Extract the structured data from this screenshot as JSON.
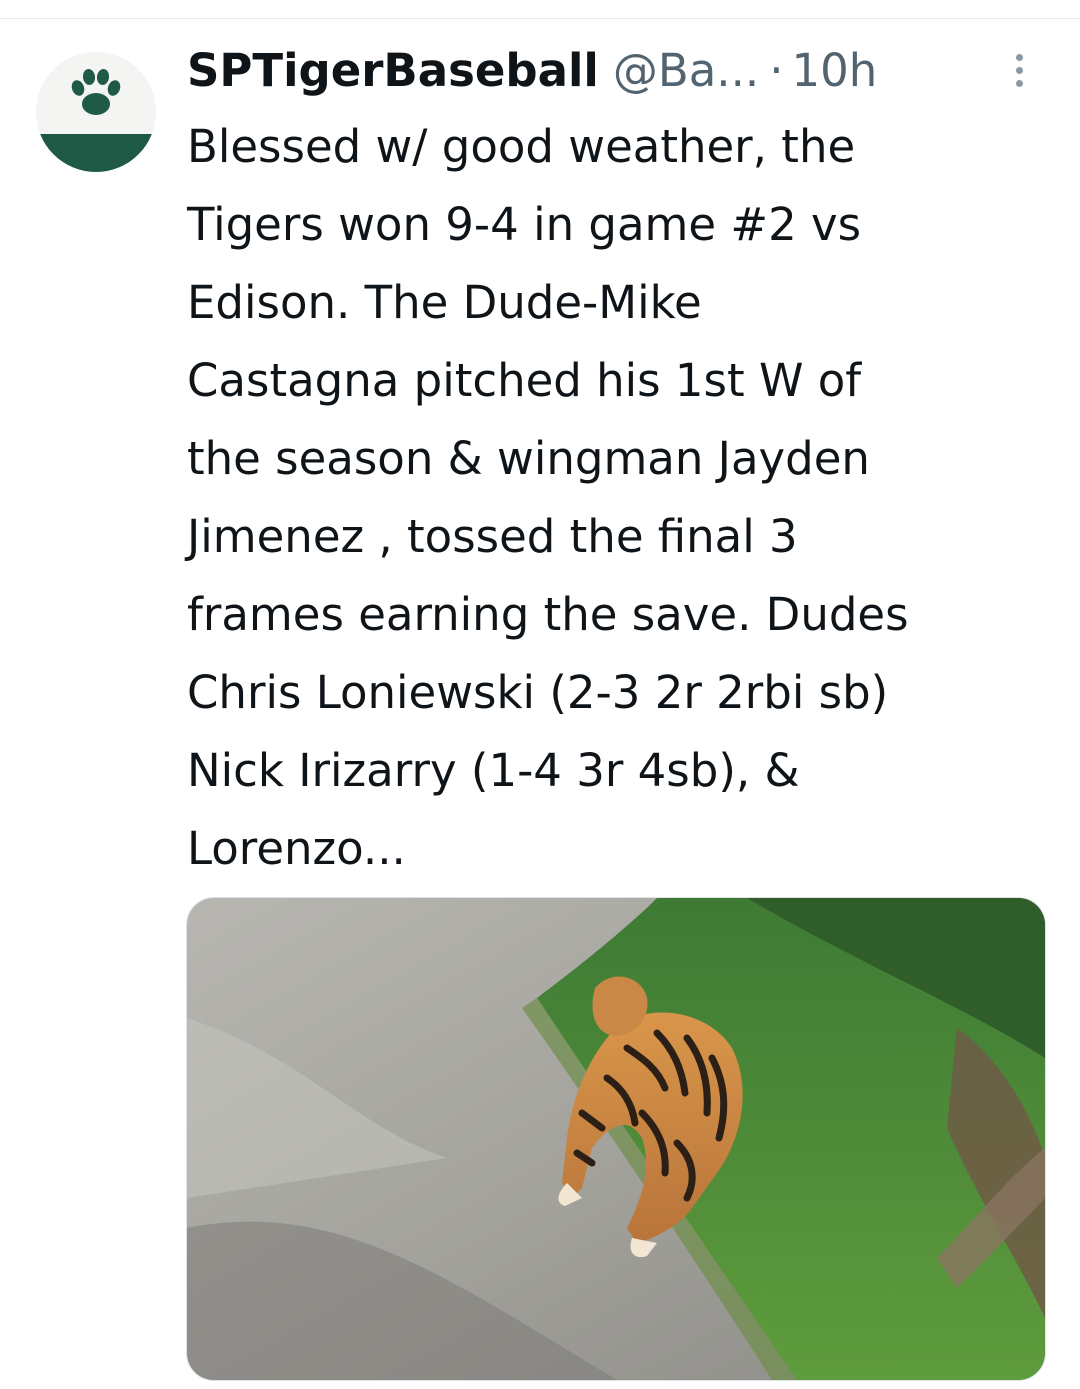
{
  "tweet": {
    "display_name": "SPTigerBaseball",
    "handle": "@Ba...",
    "separator": "·",
    "time": "10h",
    "text": "Blessed w/ good weather, the\nTigers won 9-4 in game #2 vs\nEdison.   The Dude-Mike\nCastagna pitched his 1st W of\nthe season & wingman Jayden\nJimenez , tossed the final 3\nframes earning the save.  Dudes\nChris Loniewski (2-3 2r 2rbi sb)\nNick Irizarry (1-4 3r 4sb), &\nLorenzo..."
  },
  "icons": {
    "avatar": "tiger-paw-avatar",
    "more": "more-vertical-icon"
  },
  "colors": {
    "brand_green": "#1f5a46",
    "text": "#0f1419",
    "secondary": "#536471"
  }
}
